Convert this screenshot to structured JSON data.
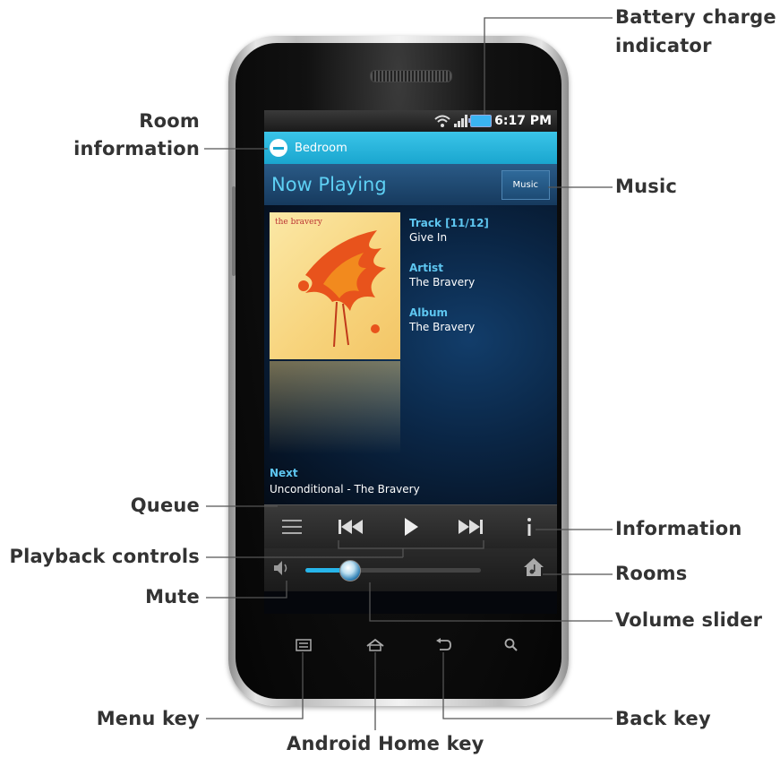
{
  "callouts": {
    "battery": "Battery charge\nindicator",
    "battery_line1": "Battery charge",
    "battery_line2": "indicator",
    "room_line1": "Room",
    "room_line2": "information",
    "music": "Music",
    "queue": "Queue",
    "information": "Information",
    "playback": "Playback controls",
    "rooms": "Rooms",
    "mute": "Mute",
    "volume": "Volume slider",
    "menu_key": "Menu key",
    "back_key": "Back key",
    "home_key": "Android Home key"
  },
  "status": {
    "time": "6:17 PM"
  },
  "room": {
    "name": "Bedroom"
  },
  "header": {
    "title": "Now Playing",
    "music_button": "Music"
  },
  "album_art": {
    "text": "the bravery"
  },
  "track": {
    "track_label": "Track [11/12]",
    "track_name": "Give In",
    "artist_label": "Artist",
    "artist_name": "The Bravery",
    "album_label": "Album",
    "album_name": "The Bravery"
  },
  "next": {
    "label": "Next",
    "value": "Unconditional - The Bravery"
  },
  "volume": {
    "level": 0.25
  },
  "icons": {
    "wifi": "wifi-icon",
    "signal": "signal-icon",
    "battery": "battery-icon",
    "queue": "queue-icon",
    "previous": "previous-track-icon",
    "play": "play-icon",
    "next": "next-track-icon",
    "info": "info-icon",
    "mute": "speaker-icon",
    "rooms": "house-music-icon",
    "menu": "menu-icon",
    "home": "home-icon",
    "back": "back-icon",
    "search": "search-icon"
  },
  "colors": {
    "accent": "#27b5ea",
    "room_bar": "#1aa6cf",
    "label": "#5ec6f0"
  }
}
